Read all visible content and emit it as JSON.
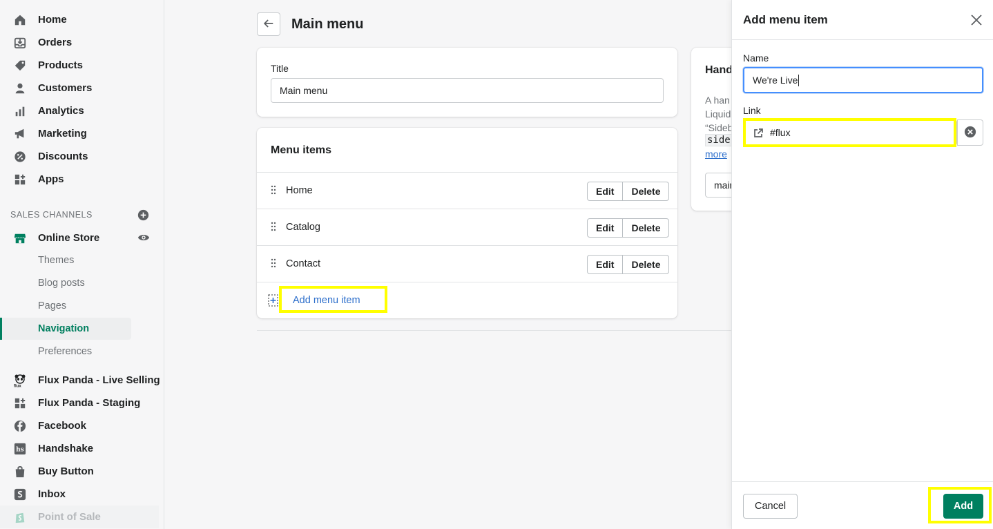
{
  "sidebar": {
    "nav": [
      "Home",
      "Orders",
      "Products",
      "Customers",
      "Analytics",
      "Marketing",
      "Discounts",
      "Apps"
    ],
    "section_title": "SALES CHANNELS",
    "online_store": "Online Store",
    "sub_items": [
      "Themes",
      "Blog posts",
      "Pages",
      "Navigation",
      "Preferences"
    ],
    "active_sub": "Navigation",
    "channels": [
      "Flux Panda - Live Selling",
      "Flux Panda - Staging",
      "Facebook",
      "Handshake",
      "Buy Button",
      "Inbox",
      "Point of Sale"
    ]
  },
  "main": {
    "page_title": "Main menu",
    "title_label": "Title",
    "title_value": "Main menu",
    "menu_items_heading": "Menu items",
    "menu_items": [
      "Home",
      "Catalog",
      "Contact"
    ],
    "edit_label": "Edit",
    "delete_label": "Delete",
    "add_menu_item": "Add menu item",
    "handle_card": {
      "heading": "Hand",
      "text_lines": [
        "A han",
        "Liquid",
        "“Sideb"
      ],
      "code": "side",
      "link": "more",
      "input_value": "mair"
    }
  },
  "panel": {
    "title": "Add menu item",
    "name_label": "Name",
    "name_value": "We're Live",
    "link_label": "Link",
    "link_value": "#flux",
    "cancel": "Cancel",
    "add": "Add"
  },
  "colors": {
    "accent": "#008060",
    "highlight": "#ffff00",
    "link": "#2c6ecb"
  }
}
